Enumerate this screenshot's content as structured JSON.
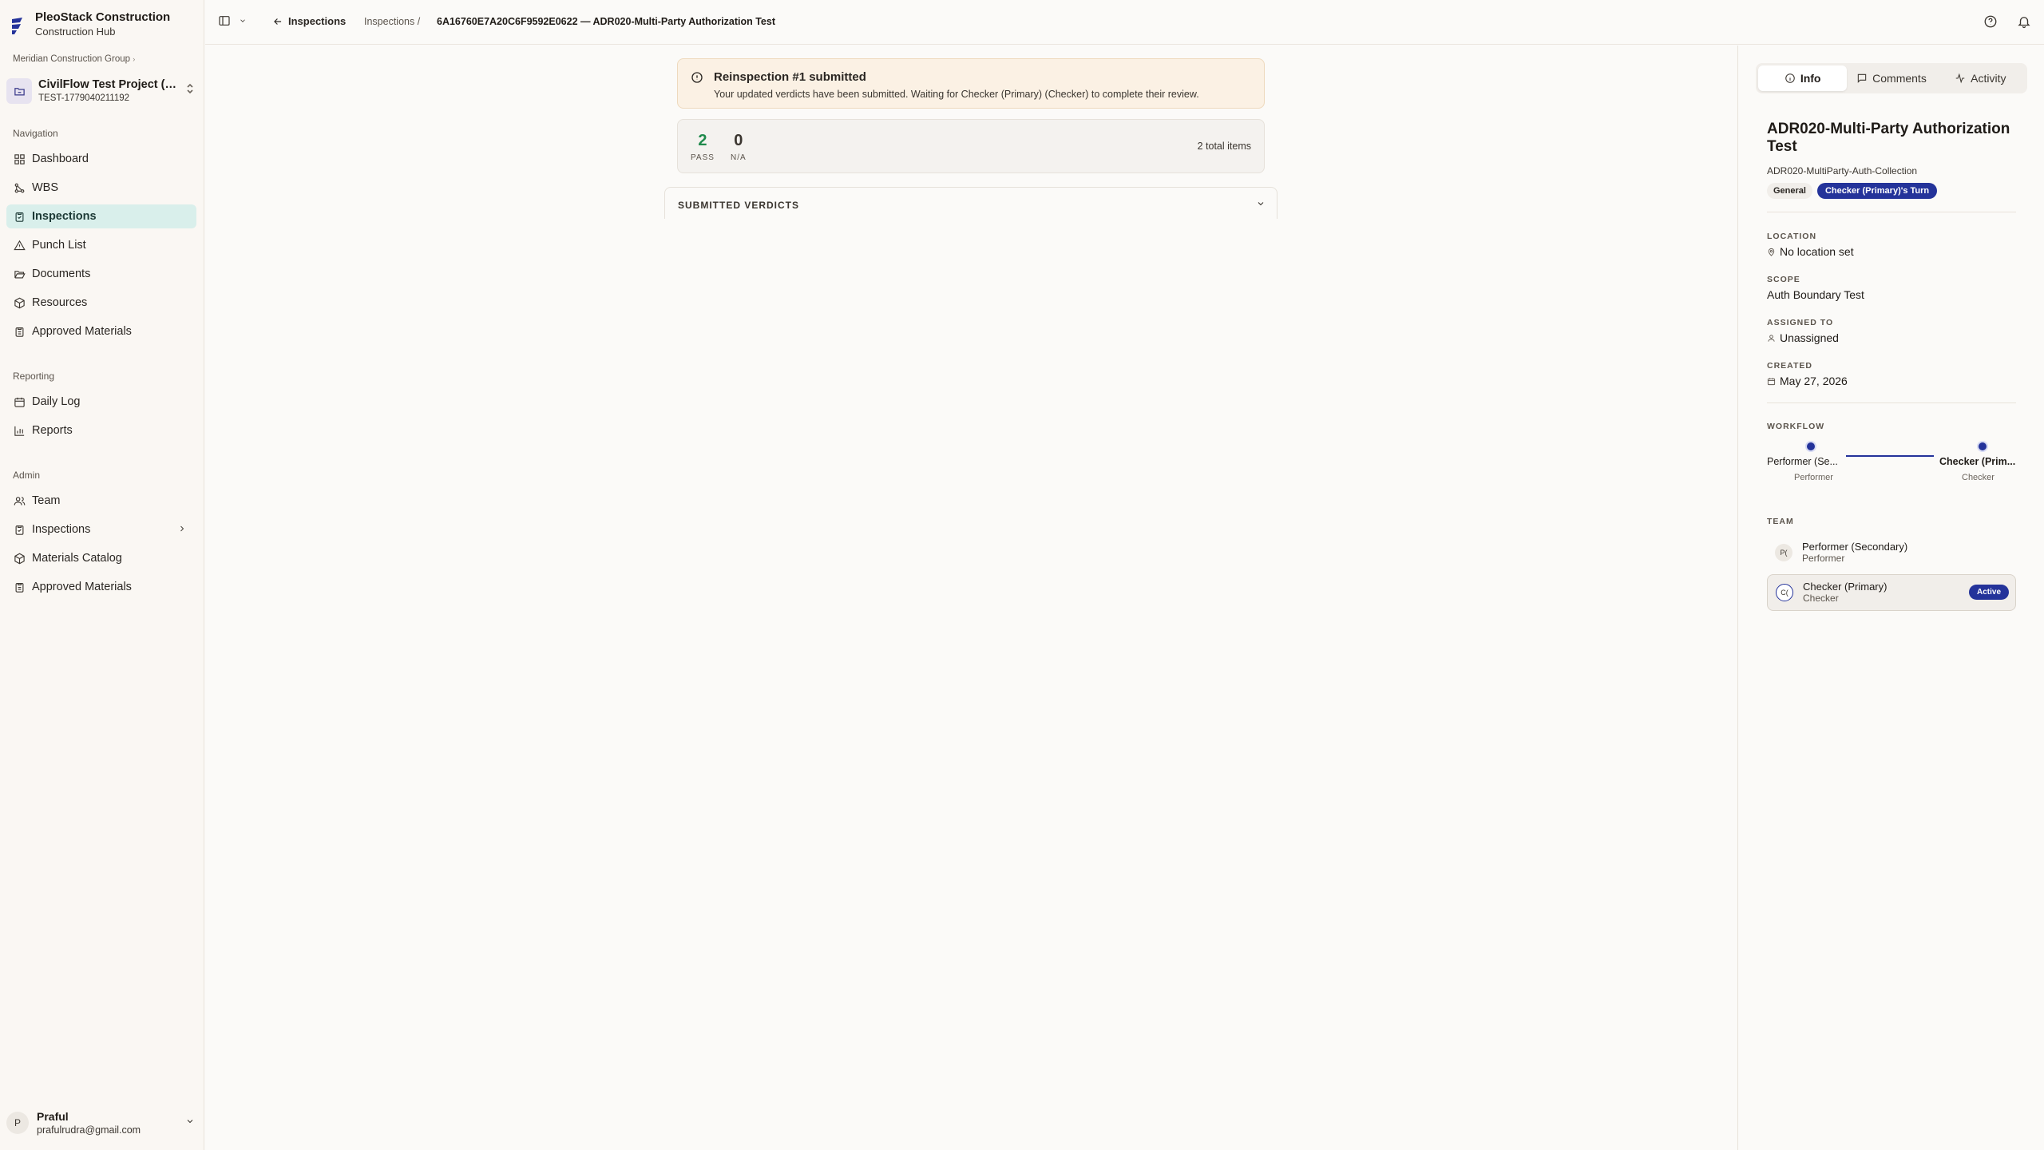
{
  "brand": {
    "name": "PleoStack Construction",
    "subtitle": "Construction Hub"
  },
  "org": "Meridian Construction Group",
  "project": {
    "name": "CivilFlow Test Project (U...",
    "code": "TEST-1779040211192"
  },
  "sections": {
    "navigation": "Navigation",
    "reporting": "Reporting",
    "admin": "Admin"
  },
  "nav": {
    "dashboard": "Dashboard",
    "wbs": "WBS",
    "inspections": "Inspections",
    "punch_list": "Punch List",
    "documents": "Documents",
    "resources": "Resources",
    "approved_materials": "Approved Materials"
  },
  "reporting": {
    "daily_log": "Daily Log",
    "reports": "Reports"
  },
  "admin": {
    "team": "Team",
    "inspections": "Inspections",
    "materials_catalog": "Materials Catalog",
    "approved_materials": "Approved Materials"
  },
  "user": {
    "initial": "P",
    "name": "Praful",
    "email": "prafulrudra@gmail.com"
  },
  "header": {
    "back_label": "Inspections",
    "breadcrumb_parent": "Inspections /",
    "breadcrumb_current": "6A16760E7A20C6F9592E0622 — ADR020-Multi-Party Authorization Test"
  },
  "banner": {
    "title": "Reinspection #1 submitted",
    "description": "Your updated verdicts have been submitted. Waiting for Checker (Primary) (Checker) to complete their review."
  },
  "stats": {
    "pass_count": "2",
    "pass_label": "PASS",
    "na_count": "0",
    "na_label": "N/A",
    "total": "2 total items",
    "pass_color": "#1f8a4c"
  },
  "verdicts": {
    "title": "SUBMITTED VERDICTS"
  },
  "panel": {
    "tabs": {
      "info": "Info",
      "comments": "Comments",
      "activity": "Activity"
    },
    "title": "ADR020-Multi-Party Authorization Test",
    "subtitle": "ADR020-MultiParty-Auth-Collection",
    "badge_general": "General",
    "badge_turn": "Checker (Primary)'s Turn",
    "location_label": "LOCATION",
    "location_value": "No location set",
    "scope_label": "SCOPE",
    "scope_value": "Auth Boundary Test",
    "assigned_label": "ASSIGNED TO",
    "assigned_value": "Unassigned",
    "created_label": "CREATED",
    "created_value": "May 27, 2026",
    "workflow_label": "WORKFLOW",
    "workflow": {
      "step1_name": "Performer (Se...",
      "step1_role": "Performer",
      "step2_name": "Checker (Prim...",
      "step2_role": "Checker"
    },
    "team_label": "TEAM",
    "team": {
      "m1_initials": "P(",
      "m1_name": "Performer (Secondary)",
      "m1_role": "Performer",
      "m2_initials": "C(",
      "m2_name": "Checker (Primary)",
      "m2_role": "Checker",
      "m2_badge": "Active"
    }
  },
  "colors": {
    "accent": "#24339a",
    "active_nav_bg": "#d9efeb",
    "banner_bg": "#fbf1e4"
  }
}
